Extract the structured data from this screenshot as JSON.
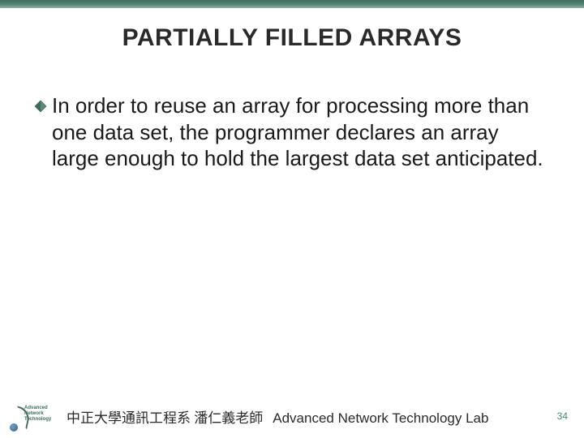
{
  "title": "PARTIALLY FILLED ARRAYS",
  "bullets": [
    {
      "text": "In order to reuse an array for processing more than one data set, the programmer declares an array large enough to hold the largest data set anticipated."
    }
  ],
  "footer": {
    "logo": {
      "l1": "Advanced",
      "l2": "Network",
      "l3": "Technology"
    },
    "cjk": "中正大學通訊工程系 潘仁義老師",
    "lab": "Advanced Network Technology Lab"
  },
  "page_number": "34"
}
